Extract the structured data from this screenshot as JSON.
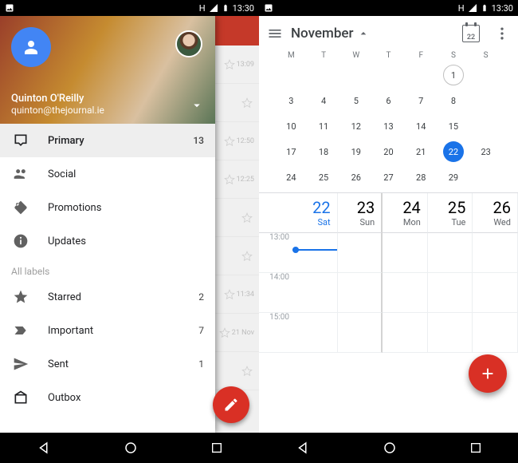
{
  "statusbar": {
    "time": "13:30",
    "net": "H"
  },
  "gmail": {
    "account": {
      "name": "Quinton O'Reilly",
      "email": "quinton@thejournal.ie"
    },
    "categories": [
      {
        "icon": "inbox",
        "label": "Primary",
        "count": "13",
        "active": true
      },
      {
        "icon": "social",
        "label": "Social",
        "count": ""
      },
      {
        "icon": "promo",
        "label": "Promotions",
        "count": ""
      },
      {
        "icon": "updates",
        "label": "Updates",
        "count": ""
      }
    ],
    "labels_header": "All labels",
    "labels": [
      {
        "icon": "star",
        "label": "Starred",
        "count": "2"
      },
      {
        "icon": "important",
        "label": "Important",
        "count": "7"
      },
      {
        "icon": "sent",
        "label": "Sent",
        "count": "1"
      },
      {
        "icon": "outbox",
        "label": "Outbox",
        "count": ""
      }
    ],
    "bg_times": [
      "13:09",
      "",
      "12:50",
      "12:25",
      "",
      "",
      "11:34",
      "21 Nov",
      ""
    ]
  },
  "calendar": {
    "month_label": "November",
    "today_badge": "22",
    "dow": [
      "M",
      "T",
      "W",
      "T",
      "F",
      "S",
      "S"
    ],
    "weeks": [
      [
        "",
        "",
        "",
        "",
        "",
        "1",
        ""
      ],
      [
        "3",
        "4",
        "5",
        "6",
        "7",
        "8",
        ""
      ],
      [
        "10",
        "11",
        "12",
        "13",
        "14",
        "15",
        ""
      ],
      [
        "17",
        "18",
        "19",
        "20",
        "21",
        "22",
        "23"
      ],
      [
        "24",
        "25",
        "26",
        "27",
        "28",
        "29",
        ""
      ]
    ],
    "today_cell": "1",
    "selected_cell": "22",
    "strip": [
      {
        "num": "22",
        "name": "Sat",
        "sel": true
      },
      {
        "num": "23",
        "name": "Sun"
      },
      {
        "num": "24",
        "name": "Mon"
      },
      {
        "num": "25",
        "name": "Tue"
      },
      {
        "num": "26",
        "name": "Wed"
      }
    ],
    "hours": [
      "13:00",
      "14:00",
      "15:00"
    ]
  }
}
